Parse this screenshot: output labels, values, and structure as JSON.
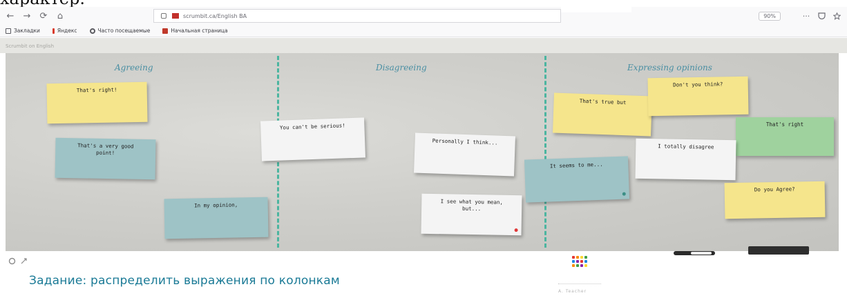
{
  "caption_top": "характер.",
  "browser": {
    "url": "scrumbit.ca/English BA",
    "zoom": "90%",
    "nav": {
      "back": "←",
      "forward": "→",
      "reload": "⟳",
      "home": "⌂"
    },
    "menu_icon": "···",
    "bookmarks": [
      {
        "label": "Закладки",
        "color": "#5a5a60"
      },
      {
        "label": "Яндекс",
        "color": "#d93a2b"
      },
      {
        "label": "Часто посещаемые",
        "color": "#5a5a60"
      },
      {
        "label": "Начальная страница",
        "color": "#c0392b"
      }
    ]
  },
  "board": {
    "header_text": "Scrumbit on English",
    "columns": [
      {
        "title": "Agreeing"
      },
      {
        "title": "Disagreeing"
      },
      {
        "title": "Expressing opinions"
      }
    ],
    "stickies": [
      {
        "text": "That's right!",
        "color": "yellow"
      },
      {
        "text": "That's a very good point!",
        "color": "teal"
      },
      {
        "text": "In my opinion,",
        "color": "teal"
      },
      {
        "text": "You can't be serious!",
        "color": "white"
      },
      {
        "text": "Personally I think...",
        "color": "white"
      },
      {
        "text": "I see what you mean, but...",
        "color": "white"
      },
      {
        "text": "It seems to me...",
        "color": "teal"
      },
      {
        "text": "That's true but",
        "color": "yellow"
      },
      {
        "text": "Don't you think?",
        "color": "yellow"
      },
      {
        "text": "That's right",
        "color": "green"
      },
      {
        "text": "I totally disagree",
        "color": "white"
      },
      {
        "text": "Do you Agree?",
        "color": "yellow"
      }
    ]
  },
  "footer": {
    "task_text": "Задание: распределить выражения по колонкам",
    "faint_text": "A. Teacher",
    "apps_colors": [
      "#e53935",
      "#fb8c00",
      "#fdd835",
      "#43a047",
      "#1e88e5",
      "#8e24aa",
      "#e53935",
      "#1e88e5",
      "#fb8c00",
      "#43a047",
      "#8e24aa",
      "#fdd835"
    ]
  }
}
